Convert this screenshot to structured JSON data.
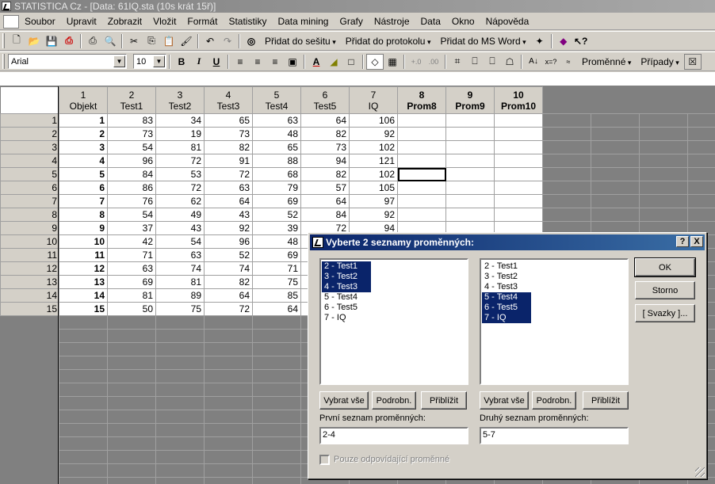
{
  "window": {
    "title": "STATISTICA Cz - [Data: 61IQ.sta (10s krát 15ř)]"
  },
  "menu": [
    "Soubor",
    "Upravit",
    "Zobrazit",
    "Vložit",
    "Formát",
    "Statistiky",
    "Data mining",
    "Grafy",
    "Nástroje",
    "Data",
    "Okno",
    "Nápověda"
  ],
  "toolbar1": {
    "add_workbook": "Přidat do sešitu",
    "add_report": "Přidat do protokolu",
    "add_word": "Přidat do MS Word"
  },
  "toolbar2": {
    "font": "Arial",
    "size": "10",
    "bold": "B",
    "italic": "I",
    "underline": "U",
    "variables": "Proměnné",
    "cases": "Případy"
  },
  "sheet": {
    "columns": [
      {
        "num": "1",
        "name": "Objekt"
      },
      {
        "num": "2",
        "name": "Test1"
      },
      {
        "num": "3",
        "name": "Test2"
      },
      {
        "num": "4",
        "name": "Test3"
      },
      {
        "num": "5",
        "name": "Test4"
      },
      {
        "num": "6",
        "name": "Test5"
      },
      {
        "num": "7",
        "name": "IQ"
      },
      {
        "num": "8",
        "name": "Prom8"
      },
      {
        "num": "9",
        "name": "Prom9"
      },
      {
        "num": "10",
        "name": "Prom10"
      }
    ],
    "rows": [
      [
        "1",
        "1",
        "83",
        "34",
        "65",
        "63",
        "64",
        "106"
      ],
      [
        "2",
        "2",
        "73",
        "19",
        "73",
        "48",
        "82",
        "92"
      ],
      [
        "3",
        "3",
        "54",
        "81",
        "82",
        "65",
        "73",
        "102"
      ],
      [
        "4",
        "4",
        "96",
        "72",
        "91",
        "88",
        "94",
        "121"
      ],
      [
        "5",
        "5",
        "84",
        "53",
        "72",
        "68",
        "82",
        "102"
      ],
      [
        "6",
        "6",
        "86",
        "72",
        "63",
        "79",
        "57",
        "105"
      ],
      [
        "7",
        "7",
        "76",
        "62",
        "64",
        "69",
        "64",
        "97"
      ],
      [
        "8",
        "8",
        "54",
        "49",
        "43",
        "52",
        "84",
        "92"
      ],
      [
        "9",
        "9",
        "37",
        "43",
        "92",
        "39",
        "72",
        "94"
      ],
      [
        "10",
        "10",
        "42",
        "54",
        "96",
        "48",
        "",
        ""
      ],
      [
        "11",
        "11",
        "71",
        "63",
        "52",
        "69",
        "",
        ""
      ],
      [
        "12",
        "12",
        "63",
        "74",
        "74",
        "71",
        "",
        ""
      ],
      [
        "13",
        "13",
        "69",
        "81",
        "82",
        "75",
        "",
        ""
      ],
      [
        "14",
        "14",
        "81",
        "89",
        "64",
        "85",
        "",
        ""
      ],
      [
        "15",
        "15",
        "50",
        "75",
        "72",
        "64",
        "",
        ""
      ]
    ]
  },
  "dialog": {
    "title": "Vyberte 2 seznamy proměnných:",
    "help": "?",
    "close": "X",
    "list1": [
      {
        "label": "2 - Test1",
        "selected": true
      },
      {
        "label": "3 - Test2",
        "selected": true
      },
      {
        "label": "4 - Test3",
        "selected": true
      },
      {
        "label": "5 - Test4",
        "selected": false
      },
      {
        "label": "6 - Test5",
        "selected": false
      },
      {
        "label": "7 - IQ",
        "selected": false
      }
    ],
    "list2": [
      {
        "label": "2 - Test1",
        "selected": false
      },
      {
        "label": "3 - Test2",
        "selected": false
      },
      {
        "label": "4 - Test3",
        "selected": false
      },
      {
        "label": "5 - Test4",
        "selected": true
      },
      {
        "label": "6 - Test5",
        "selected": true
      },
      {
        "label": "7 - IQ",
        "selected": true
      }
    ],
    "select_all": "Vybrat vše",
    "details": "Podrobn.",
    "zoom": "Přiblížit",
    "first_list_label": "První seznam proměnných:",
    "first_list_value": "2-4",
    "second_list_label": "Druhý seznam proměnných:",
    "second_list_value": "5-7",
    "only_matching": "Pouze odpovídající proměnné",
    "ok": "OK",
    "cancel": "Storno",
    "bundles": "[ Svazky ]..."
  }
}
